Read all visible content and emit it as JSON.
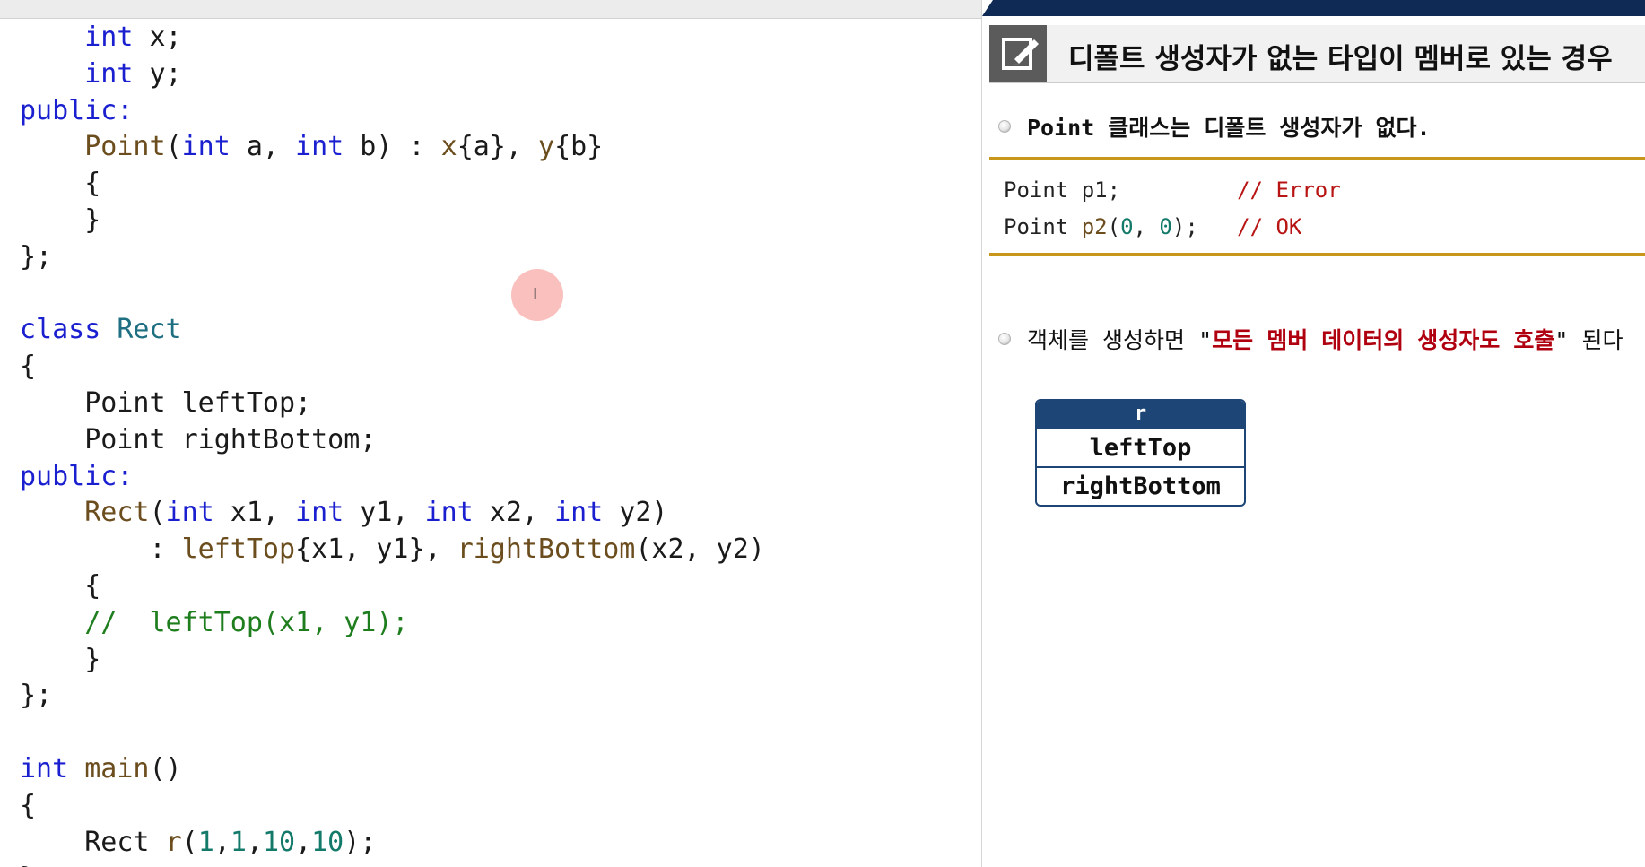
{
  "editor": {
    "lines": [
      [
        {
          "c": "pl",
          "t": "    "
        },
        {
          "c": "kw",
          "t": "int"
        },
        {
          "c": "pl",
          "t": " x;"
        }
      ],
      [
        {
          "c": "pl",
          "t": "    "
        },
        {
          "c": "kw",
          "t": "int"
        },
        {
          "c": "pl",
          "t": " y;"
        }
      ],
      [
        {
          "c": "kw",
          "t": "public:"
        }
      ],
      [
        {
          "c": "pl",
          "t": "    "
        },
        {
          "c": "fn",
          "t": "Point"
        },
        {
          "c": "pl",
          "t": "("
        },
        {
          "c": "kw",
          "t": "int"
        },
        {
          "c": "pl",
          "t": " a, "
        },
        {
          "c": "kw",
          "t": "int"
        },
        {
          "c": "pl",
          "t": " b) : "
        },
        {
          "c": "fn",
          "t": "x"
        },
        {
          "c": "pl",
          "t": "{a}, "
        },
        {
          "c": "fn",
          "t": "y"
        },
        {
          "c": "pl",
          "t": "{b}"
        }
      ],
      [
        {
          "c": "pl",
          "t": "    {"
        }
      ],
      [
        {
          "c": "pl",
          "t": "    }"
        }
      ],
      [
        {
          "c": "pl",
          "t": "};"
        }
      ],
      [
        {
          "c": "pl",
          "t": ""
        }
      ],
      [
        {
          "c": "kw",
          "t": "class"
        },
        {
          "c": "pl",
          "t": " "
        },
        {
          "c": "ty",
          "t": "Rect"
        }
      ],
      [
        {
          "c": "pl",
          "t": "{"
        }
      ],
      [
        {
          "c": "pl",
          "t": "    Point leftTop;"
        }
      ],
      [
        {
          "c": "pl",
          "t": "    Point rightBottom;"
        }
      ],
      [
        {
          "c": "kw",
          "t": "public:"
        }
      ],
      [
        {
          "c": "pl",
          "t": "    "
        },
        {
          "c": "fn",
          "t": "Rect"
        },
        {
          "c": "pl",
          "t": "("
        },
        {
          "c": "kw",
          "t": "int"
        },
        {
          "c": "pl",
          "t": " x1, "
        },
        {
          "c": "kw",
          "t": "int"
        },
        {
          "c": "pl",
          "t": " y1, "
        },
        {
          "c": "kw",
          "t": "int"
        },
        {
          "c": "pl",
          "t": " x2, "
        },
        {
          "c": "kw",
          "t": "int"
        },
        {
          "c": "pl",
          "t": " y2)"
        }
      ],
      [
        {
          "c": "pl",
          "t": "        : "
        },
        {
          "c": "fn",
          "t": "leftTop"
        },
        {
          "c": "pl",
          "t": "{x1, y1}, "
        },
        {
          "c": "fn",
          "t": "rightBottom"
        },
        {
          "c": "pl",
          "t": "(x2, y2)"
        }
      ],
      [
        {
          "c": "pl",
          "t": "    {"
        }
      ],
      [
        {
          "c": "pl",
          "t": "    "
        },
        {
          "c": "cm",
          "t": "//  leftTop(x1, y1);"
        }
      ],
      [
        {
          "c": "pl",
          "t": "    }"
        }
      ],
      [
        {
          "c": "pl",
          "t": "};"
        }
      ],
      [
        {
          "c": "pl",
          "t": ""
        }
      ],
      [
        {
          "c": "kw",
          "t": "int"
        },
        {
          "c": "pl",
          "t": " "
        },
        {
          "c": "fn",
          "t": "main"
        },
        {
          "c": "pl",
          "t": "()"
        }
      ],
      [
        {
          "c": "pl",
          "t": "{"
        }
      ],
      [
        {
          "c": "pl",
          "t": "    Rect "
        },
        {
          "c": "fn",
          "t": "r"
        },
        {
          "c": "pl",
          "t": "("
        },
        {
          "c": "num",
          "t": "1"
        },
        {
          "c": "pl",
          "t": ","
        },
        {
          "c": "num",
          "t": "1"
        },
        {
          "c": "pl",
          "t": ","
        },
        {
          "c": "num",
          "t": "10"
        },
        {
          "c": "pl",
          "t": ","
        },
        {
          "c": "num",
          "t": "10"
        },
        {
          "c": "pl",
          "t": ");"
        }
      ],
      [
        {
          "c": "pl",
          "t": "}"
        }
      ]
    ]
  },
  "slide": {
    "title": "디폴트 생성자가 없는 타입이 멤버로 있는 경우",
    "title_icon": "edit-icon",
    "bullet1": "Point 클래스는 디폴트 생성자가 없다.",
    "snippet": {
      "line1_code": "Point p1;         ",
      "line1_comment": "// Error",
      "line2_prefix": "Point ",
      "line2_fn": "p2",
      "line2_open": "(",
      "line2_num1": "0",
      "line2_sep": ", ",
      "line2_num2": "0",
      "line2_close": ");   ",
      "line2_comment": "// OK"
    },
    "bullet2": {
      "prefix": "객체를 생성하면 \"",
      "highlight": "모든 멤버 데이터의 생성자도 호출",
      "suffix": "\" 된다"
    },
    "object_box": {
      "header": "r",
      "members": [
        "leftTop",
        "rightBottom"
      ]
    }
  },
  "colors": {
    "keyword": "#1a1fcf",
    "type": "#1f6f82",
    "function": "#6b4d1e",
    "comment": "#1e7e1e",
    "number": "#137a6a",
    "slide_navy": "#0f2a55",
    "accent_gold": "#c8961b",
    "emphasis_red": "#b00010"
  }
}
